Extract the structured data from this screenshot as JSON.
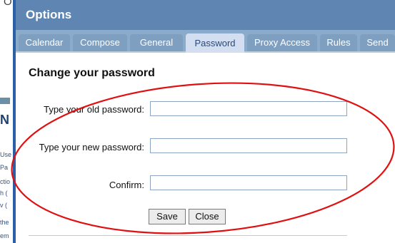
{
  "dialog": {
    "title": "Options",
    "tabs": [
      "Calendar",
      "Compose",
      "General",
      "Password",
      "Proxy Access",
      "Rules",
      "Send"
    ],
    "active_tab": "Password",
    "heading": "Change your password",
    "fields": {
      "old_label": "Type your old password:",
      "new_label": "Type your new password:",
      "confirm_label": "Confirm:",
      "old_value": "",
      "new_value": "",
      "confirm_value": ""
    },
    "buttons": {
      "save": "Save",
      "close": "Close"
    }
  },
  "background_window": {
    "fragments": [
      "O",
      "N",
      "Use",
      "Pa",
      "ctio",
      "h (",
      "v (",
      "the",
      "em"
    ]
  },
  "colors": {
    "titlebar": "#5f86b3",
    "tabstrip": "#8aabc9",
    "active_tab": "#d3dff0",
    "annotation": "#e01010"
  }
}
